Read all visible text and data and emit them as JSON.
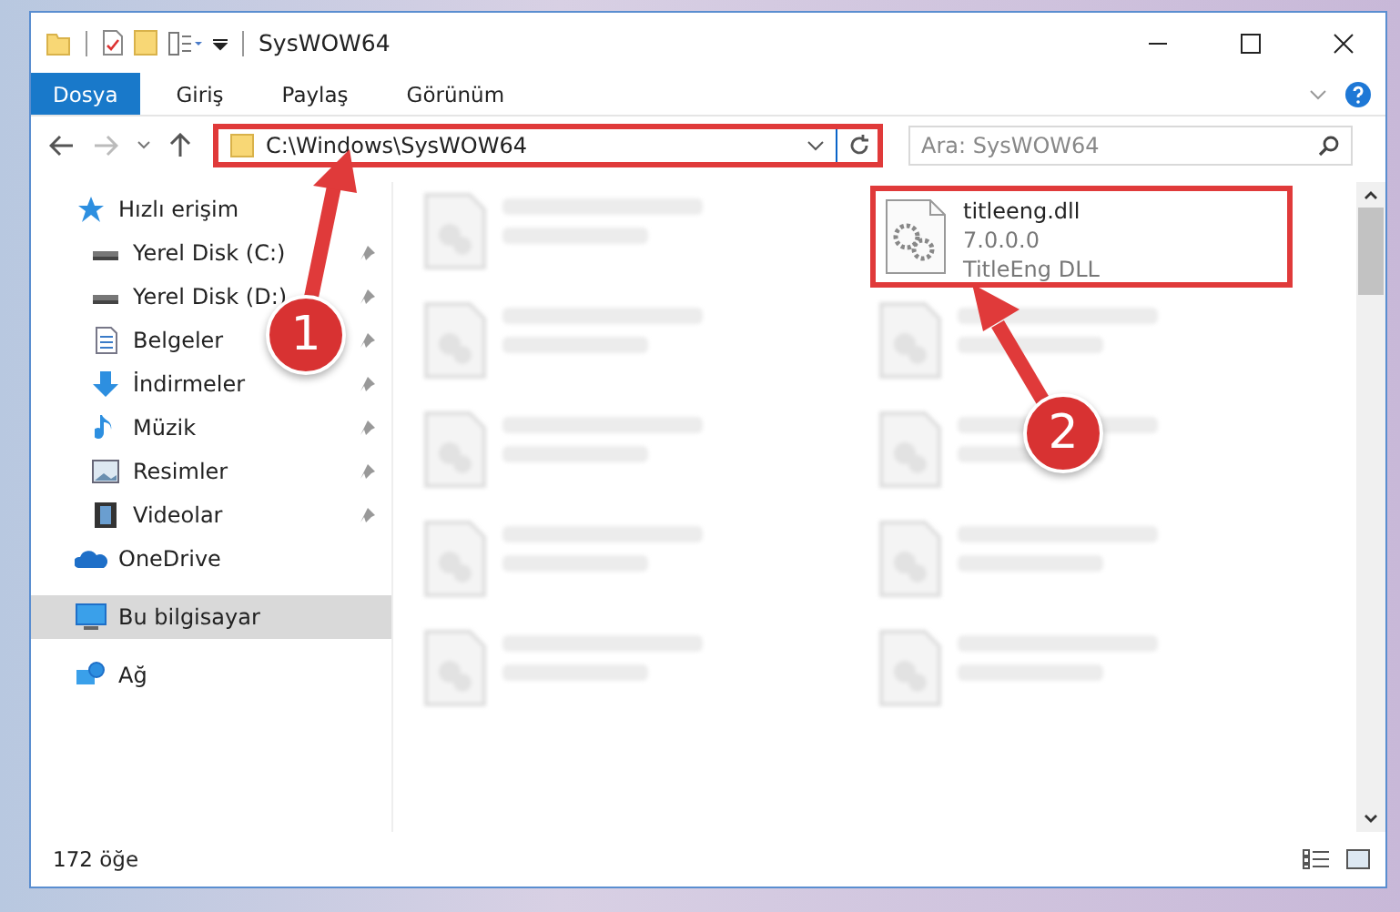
{
  "window": {
    "title": "SysWOW64"
  },
  "ribbon_tabs": [
    {
      "label": "Dosya",
      "selected": true
    },
    {
      "label": "Giriş",
      "selected": false
    },
    {
      "label": "Paylaş",
      "selected": false
    },
    {
      "label": "Görünüm",
      "selected": false
    }
  ],
  "address_bar": {
    "path": "C:\\Windows\\SysWOW64",
    "highlighted": true
  },
  "search": {
    "placeholder": "Ara: SysWOW64"
  },
  "sidebar": {
    "items": [
      {
        "label": "Hızlı erişim",
        "kind": "star",
        "pinned": false,
        "selected": false,
        "children": [
          {
            "label": "Yerel Disk (C:)",
            "kind": "drive",
            "pinned": true,
            "selected": false
          },
          {
            "label": "Yerel Disk (D:)",
            "kind": "drive",
            "pinned": true,
            "selected": false
          },
          {
            "label": "Belgeler",
            "kind": "document",
            "pinned": true,
            "selected": false
          },
          {
            "label": "İndirmeler",
            "kind": "download",
            "pinned": true,
            "selected": false
          },
          {
            "label": "Müzik",
            "kind": "music",
            "pinned": true,
            "selected": false
          },
          {
            "label": "Resimler",
            "kind": "picture",
            "pinned": true,
            "selected": false
          },
          {
            "label": "Videolar",
            "kind": "video",
            "pinned": true,
            "selected": false
          }
        ]
      },
      {
        "label": "OneDrive",
        "kind": "cloud",
        "pinned": false,
        "selected": false
      },
      {
        "label": "Bu bilgisayar",
        "kind": "computer",
        "pinned": false,
        "selected": true
      },
      {
        "label": "Ağ",
        "kind": "network",
        "pinned": false,
        "selected": false
      }
    ]
  },
  "files": [
    {
      "blurred": true,
      "highlighted": false
    },
    {
      "name": "titleeng.dll",
      "line_2": "7.0.0.0",
      "line_3": "TitleEng DLL",
      "blurred": false,
      "highlighted": true
    },
    {
      "blurred": true,
      "highlighted": false
    },
    {
      "blurred": true,
      "highlighted": false
    },
    {
      "blurred": true,
      "highlighted": false
    },
    {
      "blurred": true,
      "highlighted": false
    },
    {
      "blurred": true,
      "highlighted": false
    },
    {
      "blurred": true,
      "highlighted": false
    },
    {
      "blurred": true,
      "highlighted": false
    },
    {
      "blurred": true,
      "highlighted": false
    }
  ],
  "status_bar": {
    "item_count": "172 öğe"
  },
  "callouts": [
    {
      "label": "1"
    },
    {
      "label": "2"
    }
  ]
}
